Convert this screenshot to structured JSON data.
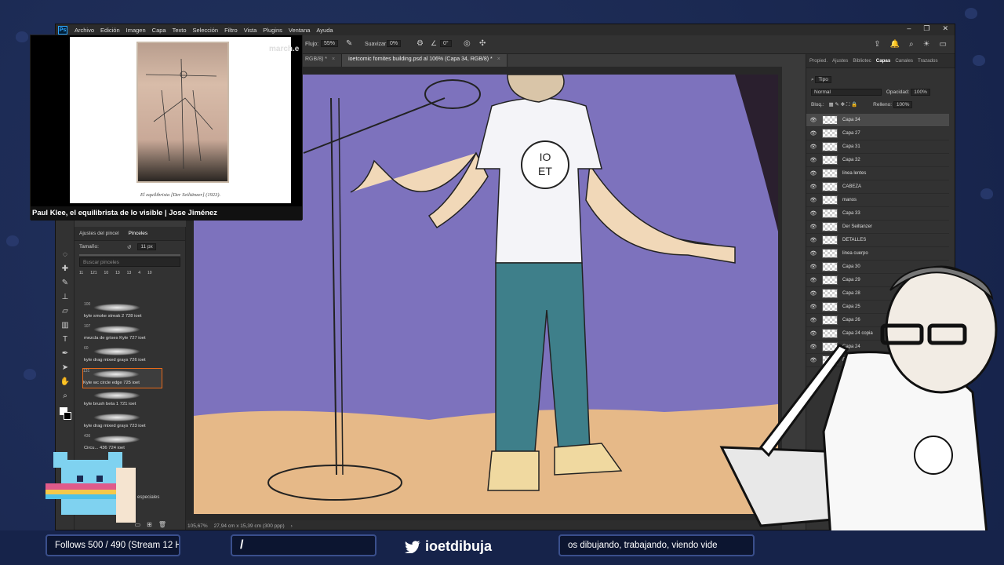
{
  "ps": {
    "menu": [
      "Archivo",
      "Edición",
      "Imagen",
      "Capa",
      "Texto",
      "Selección",
      "Filtro",
      "Vista",
      "Plugins",
      "Ventana",
      "Ayuda"
    ],
    "options": {
      "flujo_label": "Flujo:",
      "flujo_value": "55%",
      "suavizar_label": "Suavizar:",
      "suavizar_value": "0%",
      "angle_value": "0°"
    },
    "tabs": [
      {
        "label": "RGB/8) *",
        "active": false
      },
      {
        "label": "ioetcomic fornites building.psd al 106% (Capa 34, RGB/8) *",
        "active": true
      }
    ],
    "status": {
      "zoom": "105,67%",
      "dims": "27,94 cm x 15,39 cm (300 ppp)"
    }
  },
  "brushes": {
    "tabs": [
      "Ajustes del pincel",
      "Pinceles"
    ],
    "size_label": "Tamaño:",
    "size_value": "11 px",
    "search_placeholder": "Buscar pinceles",
    "presets": [
      "11",
      "121",
      "10",
      "13",
      "13",
      "4",
      "10"
    ],
    "items": [
      {
        "num": "100",
        "name": "kyle smoke streak 2 728 ioet"
      },
      {
        "num": "107",
        "name": "mezcla de grises Kyle 727 ioet"
      },
      {
        "num": "60",
        "name": "kyle drag mixed grays 726 ioet"
      },
      {
        "num": "131",
        "name": "Kyle wc circle edge 725 ioet"
      },
      {
        "num": "",
        "name": "kyle brush beta 1 721 ioet"
      },
      {
        "num": "",
        "name": "kyle drag mixed grays 723 ioet"
      },
      {
        "num": "436",
        "name": "Circu... 436 724 ioet"
      }
    ],
    "folder_label": "especiales"
  },
  "layers": {
    "tabs": [
      "Propied.",
      "Ajustes",
      "Bibliotec",
      "Capas",
      "Canales",
      "Trazados"
    ],
    "filter_label": "Tipo",
    "blend_mode": "Normal",
    "opacity_label": "Opacidad:",
    "opacity_value": "100%",
    "lock_label": "Bloq.:",
    "fill_label": "Relleno:",
    "fill_value": "100%",
    "list": [
      "Capa 34",
      "Capa 27",
      "Capa 31",
      "Capa 32",
      "linea lentes",
      "CABEZA",
      "manos",
      "Capa 33",
      "Der Seiltanzer",
      "DETALLES",
      "linea cuerpo",
      "Capa 30",
      "Capa 29",
      "Capa 28",
      "Capa 25",
      "Capa 26",
      "Capa 24 copia",
      "Capa 24",
      "Fondo"
    ]
  },
  "webcam": {
    "caption": "El equilibrista [Der Seiltänzer] (1923).",
    "title": "Paul Klee, el equilibrista de lo visible | Jose Jiménez",
    "marquee": "march.e"
  },
  "bottom": {
    "follows": "Follows 500 / 490 (Stream 12 H)",
    "command": "/",
    "twitter": "ioetdibuja",
    "ticker": "os dibujando, trabajando, viendo vide"
  },
  "canvas_art": {
    "shirt_logo_top": "IO",
    "shirt_logo_bottom": "ET"
  }
}
